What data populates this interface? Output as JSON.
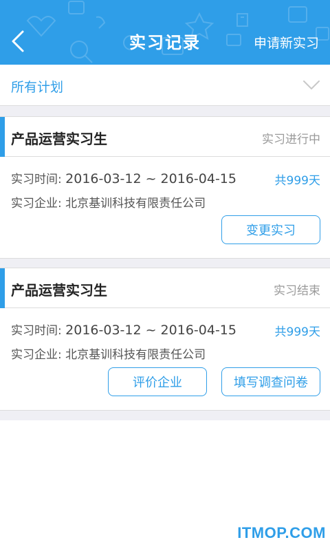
{
  "header": {
    "title": "实习记录",
    "apply_label": "申请新实习",
    "back_icon": "chevron-left-icon",
    "background_color": "#2f9ee8"
  },
  "filter": {
    "label": "所有计划",
    "icon": "chevron-down-icon"
  },
  "records": [
    {
      "title": "产品运营实习生",
      "status": "实习进行中",
      "time_label": "实习时间:",
      "date_range": "2016-03-12 ~ 2016-04-15",
      "days": "共999天",
      "company_label": "实习企业:",
      "company": "北京基训科技有限责任公司",
      "buttons": [
        "变更实习"
      ]
    },
    {
      "title": "产品运营实习生",
      "status": "实习结束",
      "time_label": "实习时间:",
      "date_range": "2016-03-12 ~ 2016-04-15",
      "days": "共999天",
      "company_label": "实习企业:",
      "company": "北京基训科技有限责任公司",
      "buttons": [
        "评价企业",
        "填写调查问卷"
      ]
    }
  ],
  "watermark": "ITMOP.COM",
  "colors": {
    "accent": "#2f9ee8",
    "muted": "#9a9a9a",
    "divider": "#efeff4"
  }
}
